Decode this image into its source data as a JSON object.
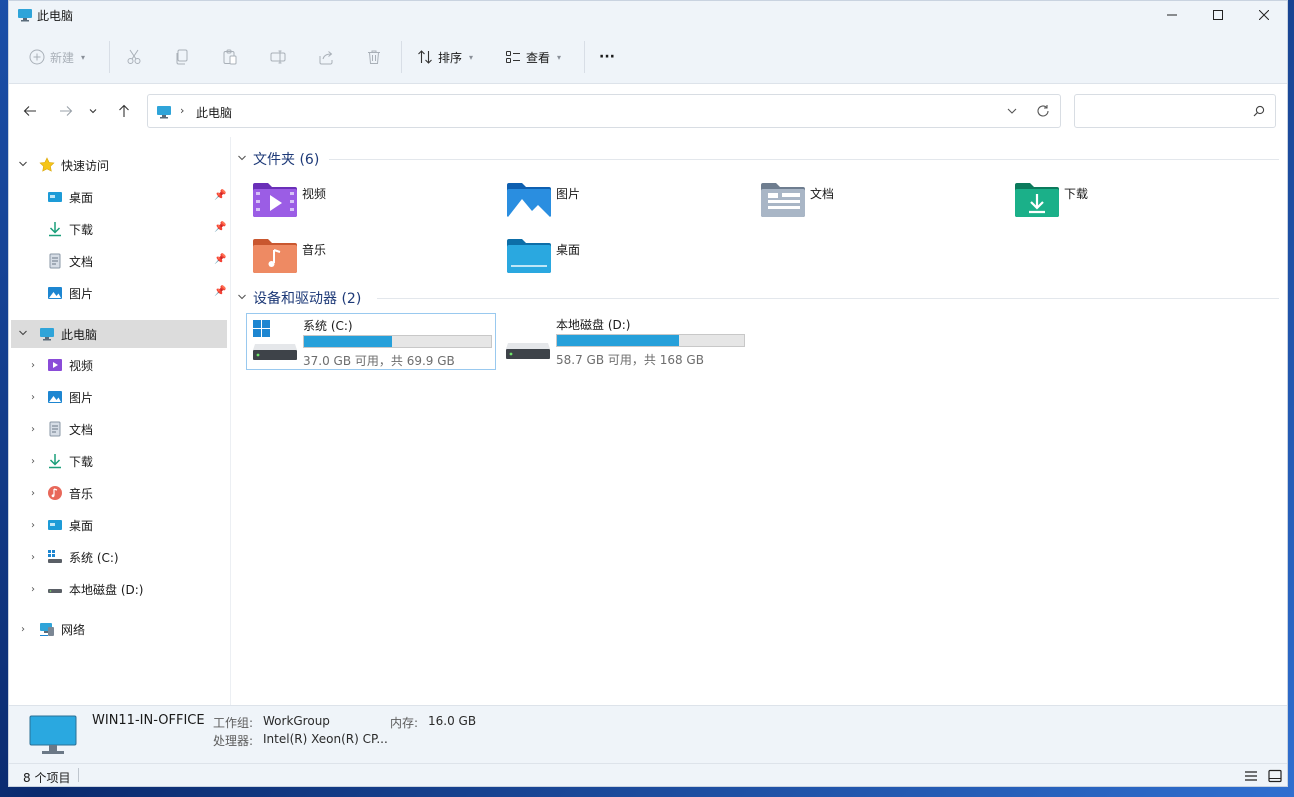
{
  "window": {
    "title": "此电脑"
  },
  "toolbar": {
    "new_label": "新建",
    "sort_label": "排序",
    "view_label": "查看",
    "more_label": "···"
  },
  "address": {
    "crumb": "此电脑",
    "separator": "›"
  },
  "search": {
    "placeholder": ""
  },
  "sidebar": {
    "quick_access": "快速访问",
    "quick_items": [
      {
        "label": "桌面",
        "icon": "desktop-folder-icon"
      },
      {
        "label": "下载",
        "icon": "download-icon"
      },
      {
        "label": "文档",
        "icon": "document-icon"
      },
      {
        "label": "图片",
        "icon": "picture-icon"
      }
    ],
    "this_pc": "此电脑",
    "pc_items": [
      {
        "label": "视频",
        "icon": "video-icon"
      },
      {
        "label": "图片",
        "icon": "picture-icon"
      },
      {
        "label": "文档",
        "icon": "document-icon"
      },
      {
        "label": "下载",
        "icon": "download-icon"
      },
      {
        "label": "音乐",
        "icon": "music-icon"
      },
      {
        "label": "桌面",
        "icon": "desktop-folder-icon"
      },
      {
        "label": "系统 (C:)",
        "icon": "system-drive-icon"
      },
      {
        "label": "本地磁盘 (D:)",
        "icon": "local-drive-icon"
      }
    ],
    "network": "网络"
  },
  "content": {
    "folders_header": "文件夹 (6)",
    "folders": [
      {
        "label": "视频",
        "icon": "video-folder-icon"
      },
      {
        "label": "图片",
        "icon": "picture-folder-icon"
      },
      {
        "label": "文档",
        "icon": "document-folder-icon"
      },
      {
        "label": "下载",
        "icon": "download-folder-icon"
      },
      {
        "label": "音乐",
        "icon": "music-folder-icon"
      },
      {
        "label": "桌面",
        "icon": "desktop-folder-icon"
      }
    ],
    "drives_header": "设备和驱动器 (2)",
    "drives": [
      {
        "label": "系统 (C:)",
        "info": "37.0 GB 可用，共 69.9 GB",
        "used_fraction": 0.47
      },
      {
        "label": "本地磁盘 (D:)",
        "info": "58.7 GB 可用，共 168 GB",
        "used_fraction": 0.65
      }
    ]
  },
  "details": {
    "pc_name": "WIN11-IN-OFFICE",
    "workgroup_key": "工作组:",
    "workgroup_val": "WorkGroup",
    "memory_key": "内存:",
    "memory_val": "16.0 GB",
    "cpu_key": "处理器:",
    "cpu_val": "Intel(R) Xeon(R) CP..."
  },
  "status": {
    "item_count": "8 个项目"
  },
  "colors": {
    "accent": "#26a0da",
    "header": "#1e3a78"
  }
}
